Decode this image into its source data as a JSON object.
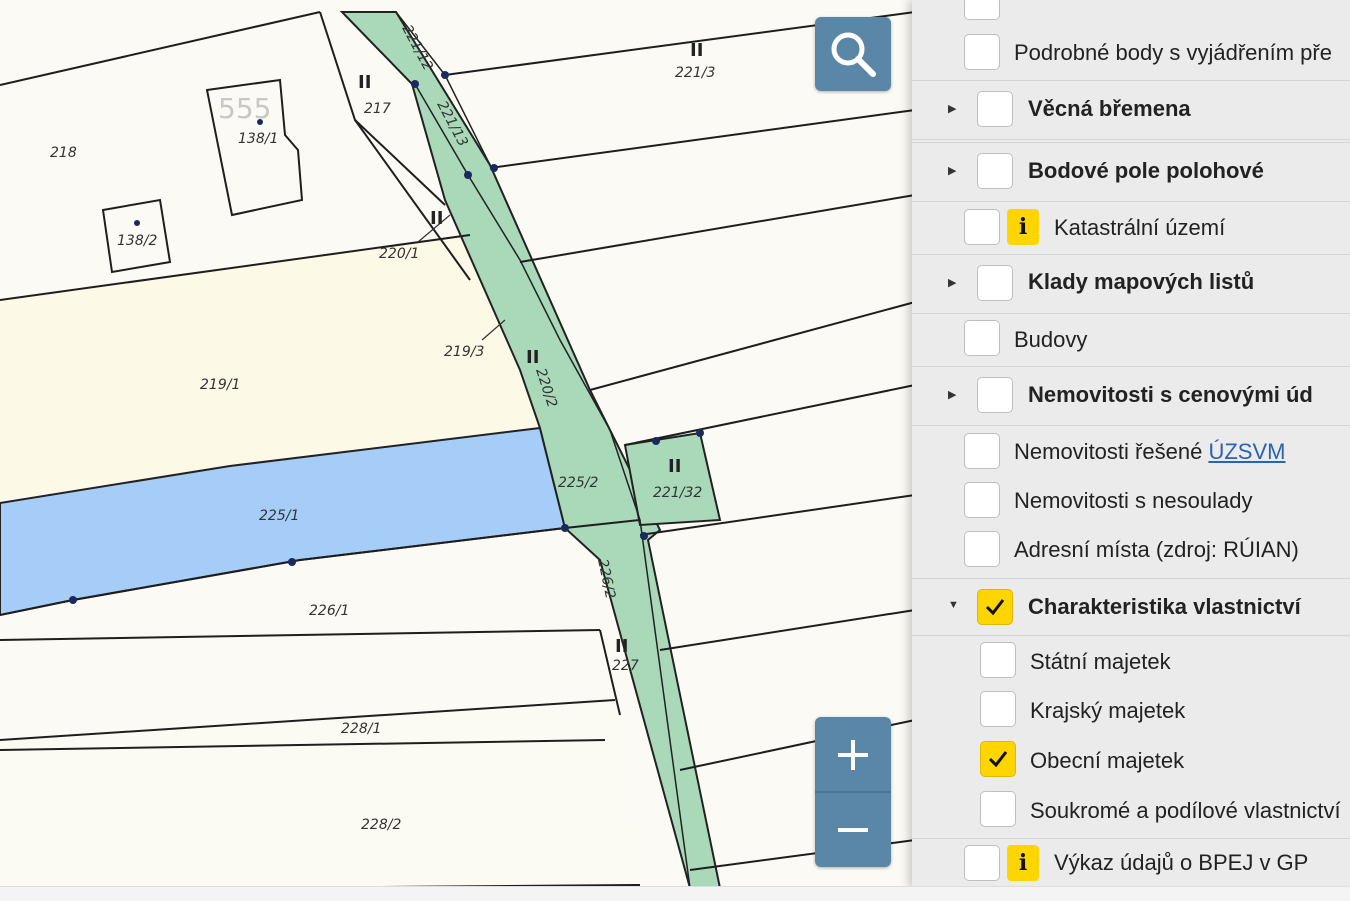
{
  "map": {
    "house_number": "555",
    "parcels": [
      "218",
      "217",
      "221/12",
      "221/13",
      "221/3",
      "138/1",
      "138/2",
      "220/1",
      "219/3",
      "219/1",
      "220/2",
      "225/2",
      "221/32",
      "225/1",
      "226/1",
      "226/2",
      "227",
      "228/1",
      "228/2"
    ],
    "colors": {
      "road_fill": "#a9d9b8",
      "selected_parcel_fill": "#a6cdf7",
      "parcel_line": "#1e1e1e",
      "background": "#fbfaf4"
    }
  },
  "controls": {
    "search_icon": "search-icon",
    "zoom_in_icon": "plus-icon",
    "zoom_out_icon": "minus-icon"
  },
  "layers": {
    "items": [
      {
        "label": "Podrobné body s vyjádřením pře",
        "checked": false
      },
      {
        "label": "Věcná břemena",
        "checked": false,
        "group": true
      },
      {
        "label": "Bodové pole polohové",
        "checked": false,
        "group": true
      },
      {
        "label": "Katastrální území",
        "checked": false,
        "info": true
      },
      {
        "label": "Klady mapových listů",
        "checked": false,
        "group": true
      },
      {
        "label": "Budovy",
        "checked": false
      },
      {
        "label": "Nemovitosti s cenovými úd",
        "checked": false,
        "group": true
      },
      {
        "label": "Nemovitosti řešené",
        "link": "ÚZSVM",
        "checked": false
      },
      {
        "label": "Nemovitosti s nesoulady",
        "checked": false
      },
      {
        "label": "Adresní místa (zdroj: RÚIAN)",
        "checked": false
      },
      {
        "label": "Charakteristika vlastnictví",
        "checked": true,
        "group": true,
        "expanded": true
      },
      {
        "label": "Státní majetek",
        "checked": false
      },
      {
        "label": "Krajský majetek",
        "checked": false
      },
      {
        "label": "Obecní majetek",
        "checked": true
      },
      {
        "label": "Soukromé a podílové vlastnictví",
        "checked": false
      },
      {
        "label": "Výkaz údajů o BPEJ v GP",
        "checked": false,
        "info": true
      }
    ],
    "info_glyph": "i"
  }
}
